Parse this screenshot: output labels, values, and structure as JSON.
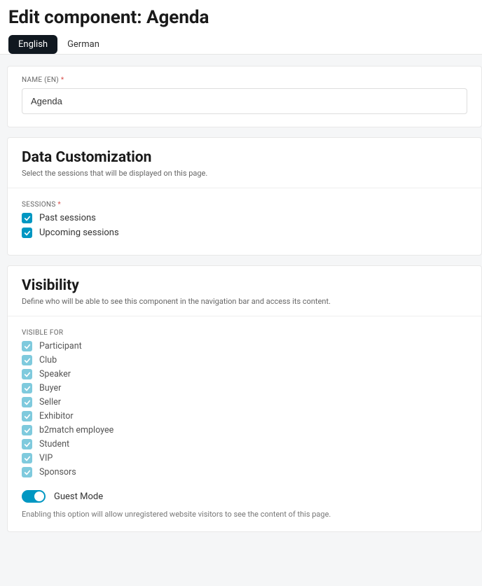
{
  "header": {
    "title": "Edit component: Agenda",
    "tabs": [
      {
        "label": "English"
      },
      {
        "label": "German"
      }
    ]
  },
  "name_section": {
    "label": "NAME (EN)",
    "value": "Agenda"
  },
  "data_customization": {
    "title": "Data Customization",
    "desc": "Select the sessions that will be displayed on this page.",
    "sessions_label": "SESSIONS",
    "options": [
      {
        "label": "Past sessions"
      },
      {
        "label": "Upcoming sessions"
      }
    ]
  },
  "visibility": {
    "title": "Visibility",
    "desc": "Define who will be able to see this component in the navigation bar and access its content.",
    "visible_for_label": "VISIBLE FOR",
    "roles": [
      {
        "label": "Participant"
      },
      {
        "label": "Club"
      },
      {
        "label": "Speaker"
      },
      {
        "label": "Buyer"
      },
      {
        "label": "Seller"
      },
      {
        "label": "Exhibitor"
      },
      {
        "label": "b2match employee"
      },
      {
        "label": "Student"
      },
      {
        "label": "VIP"
      },
      {
        "label": "Sponsors"
      }
    ],
    "guest_mode_label": "Guest Mode",
    "guest_mode_note": "Enabling this option will allow unregistered website visitors to see the content of this page."
  }
}
